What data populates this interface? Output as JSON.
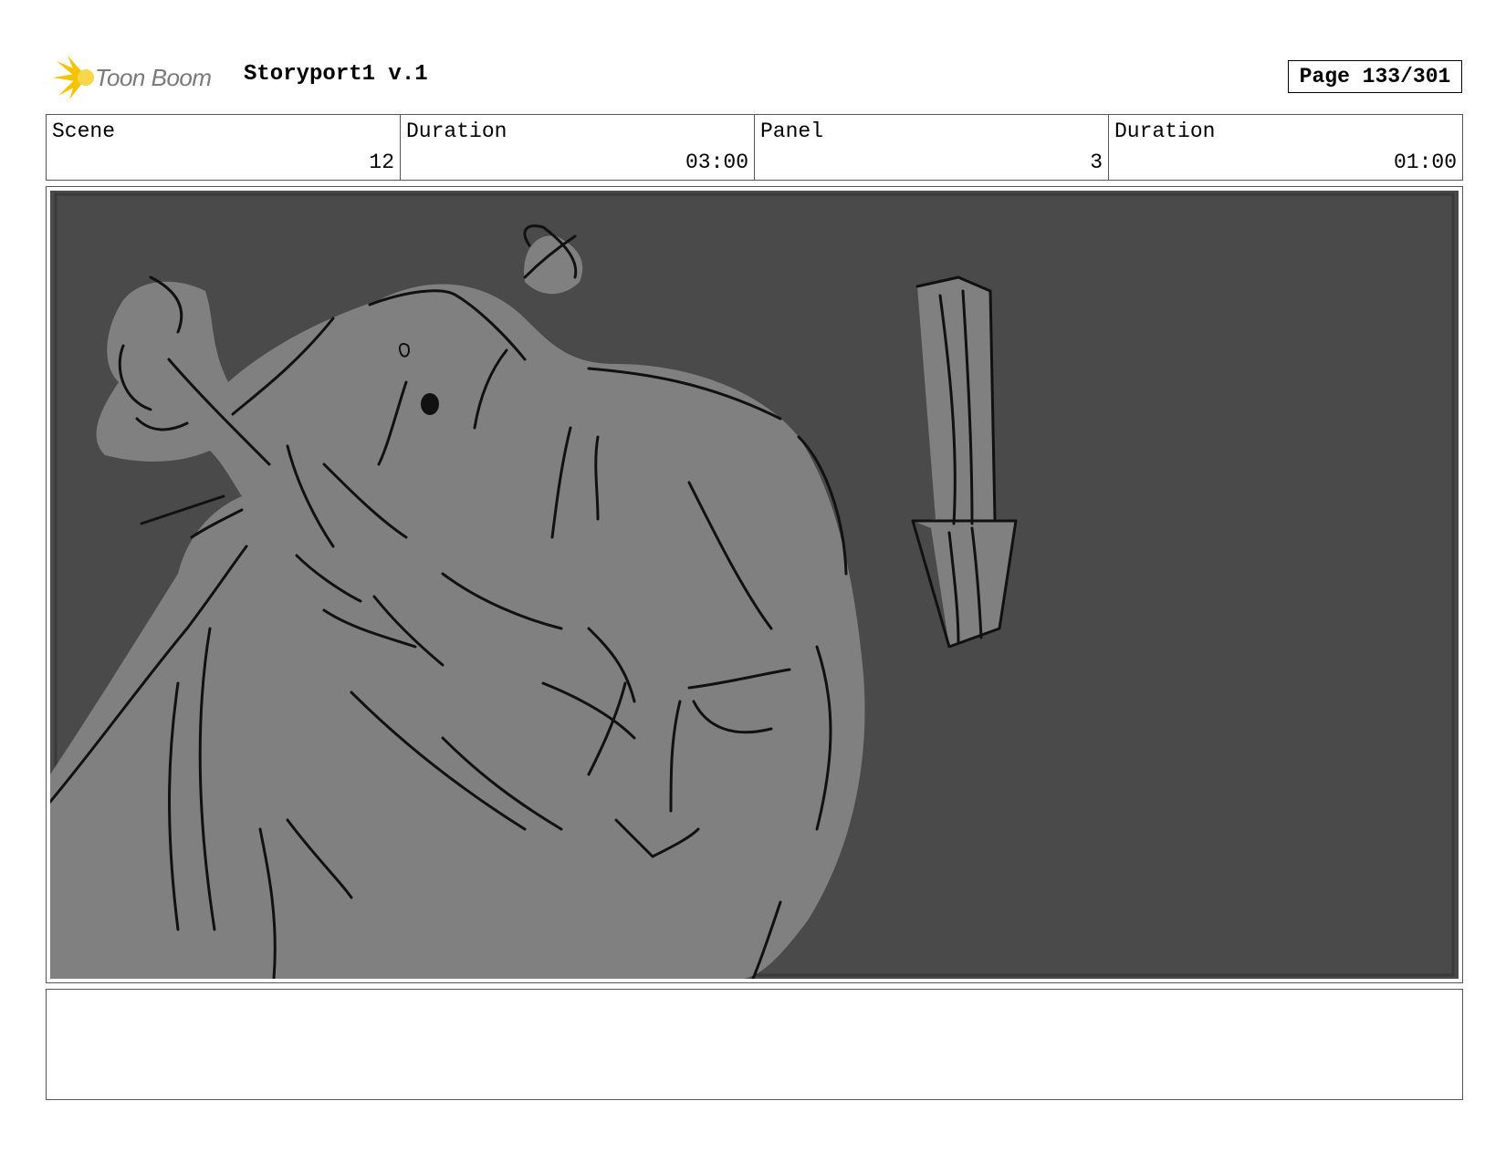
{
  "header": {
    "logo_text": "Toon Boom",
    "project_title": "Storyport1 v.1",
    "page_label": "Page 133/301"
  },
  "info": [
    {
      "label": "Scene",
      "value": "12"
    },
    {
      "label": "Duration",
      "value": "03:00"
    },
    {
      "label": "Panel",
      "value": "3"
    },
    {
      "label": "Duration",
      "value": "01:00"
    }
  ],
  "colors": {
    "panel_background": "#4a4a4a",
    "figure_fill": "#808080",
    "line": "#111111",
    "logo_yellow": "#f5c400"
  },
  "notes": ""
}
